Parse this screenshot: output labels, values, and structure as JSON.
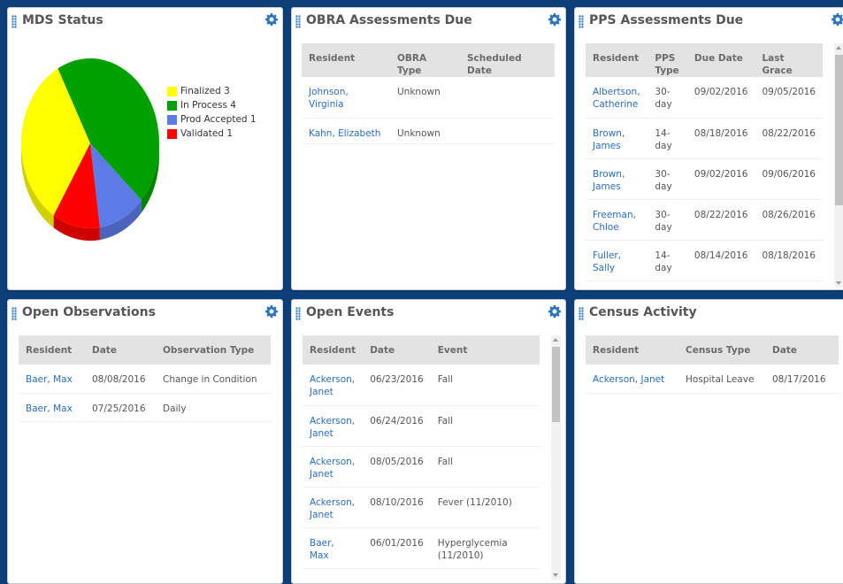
{
  "mds": {
    "title": "MDS Status",
    "legend": [
      {
        "label": "Finalized 3",
        "color": "#ffff00"
      },
      {
        "label": "In Process 4",
        "color": "#00a000"
      },
      {
        "label": "Prod Accepted 1",
        "color": "#5b7be6"
      },
      {
        "label": "Validated 1",
        "color": "#ff0000"
      }
    ]
  },
  "chart_data": {
    "type": "pie",
    "categories": [
      "Finalized",
      "In Process",
      "Prod Accepted",
      "Validated"
    ],
    "values": [
      3,
      4,
      1,
      1
    ],
    "colors": [
      "#ffff00",
      "#00a000",
      "#5b7be6",
      "#ff0000"
    ],
    "legend_position": "right"
  },
  "obra": {
    "title": "OBRA Assessments Due",
    "columns": [
      "Resident",
      "OBRA Type",
      "Scheduled Date"
    ],
    "rows": [
      {
        "resident": [
          "Johnson,",
          "Virginia"
        ],
        "type": "Unknown",
        "date": ""
      },
      {
        "resident": [
          "Kahn, Elizabeth"
        ],
        "type": "Unknown",
        "date": ""
      }
    ]
  },
  "pps": {
    "title": "PPS Assessments Due",
    "columns": [
      [
        "Resident"
      ],
      [
        "PPS",
        "Type"
      ],
      [
        "Due Date"
      ],
      [
        "Last",
        "Grace"
      ]
    ],
    "rows": [
      {
        "resident": [
          "Albertson,",
          "Catherine"
        ],
        "type": [
          "30-",
          "day"
        ],
        "due": "09/02/2016",
        "grace": "09/05/2016"
      },
      {
        "resident": [
          "Brown,",
          "James"
        ],
        "type": [
          "14-",
          "day"
        ],
        "due": "08/18/2016",
        "grace": "08/22/2016"
      },
      {
        "resident": [
          "Brown,",
          "James"
        ],
        "type": [
          "30-",
          "day"
        ],
        "due": "09/02/2016",
        "grace": "09/06/2016"
      },
      {
        "resident": [
          "Freeman,",
          "Chloe"
        ],
        "type": [
          "30-",
          "day"
        ],
        "due": "08/22/2016",
        "grace": "08/26/2016"
      },
      {
        "resident": [
          "Fuller,",
          "Sally"
        ],
        "type": [
          "14-",
          "day"
        ],
        "due": "08/14/2016",
        "grace": "08/18/2016"
      }
    ]
  },
  "observations": {
    "title": "Open Observations",
    "columns": [
      "Resident",
      "Date",
      "Observation Type"
    ],
    "rows": [
      {
        "resident": "Baer, Max",
        "date": "08/08/2016",
        "type": "Change in Condition"
      },
      {
        "resident": "Baer, Max",
        "date": "07/25/2016",
        "type": "Daily"
      }
    ]
  },
  "events": {
    "title": "Open Events",
    "columns": [
      "Resident",
      "Date",
      "Event"
    ],
    "rows": [
      {
        "resident": [
          "Ackerson,",
          "Janet"
        ],
        "date": "06/23/2016",
        "event": [
          "Fall"
        ]
      },
      {
        "resident": [
          "Ackerson,",
          "Janet"
        ],
        "date": "06/24/2016",
        "event": [
          "Fall"
        ]
      },
      {
        "resident": [
          "Ackerson,",
          "Janet"
        ],
        "date": "08/05/2016",
        "event": [
          "Fall"
        ]
      },
      {
        "resident": [
          "Ackerson,",
          "Janet"
        ],
        "date": "08/10/2016",
        "event": [
          "Fever (11/2010)"
        ]
      },
      {
        "resident": [
          "Baer, Max"
        ],
        "date": "06/01/2016",
        "event": [
          "Hyperglycemia",
          "(11/2010)"
        ]
      }
    ]
  },
  "census": {
    "title": "Census Activity",
    "columns": [
      "Resident",
      "Census Type",
      "Date"
    ],
    "rows": [
      {
        "resident": "Ackerson, Janet",
        "type": "Hospital Leave",
        "date": "08/17/2016"
      }
    ]
  },
  "colors": {
    "background": "#0d3f7a",
    "link": "#2a6ebd",
    "header_bg": "#e3e3e3",
    "accent": "#2b74c0"
  },
  "icons": {
    "grip": "drag-grip-icon",
    "gear": "gear-icon"
  }
}
